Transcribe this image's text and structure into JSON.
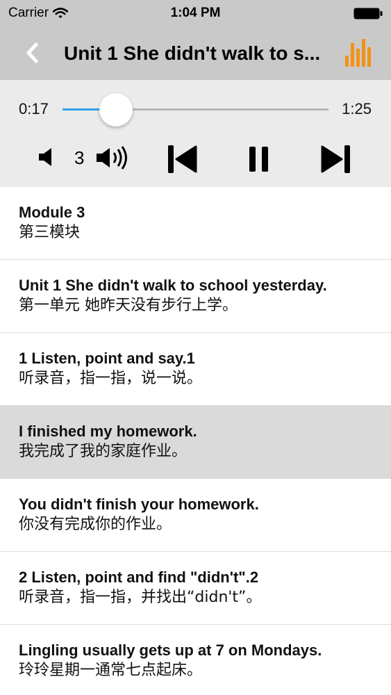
{
  "status_bar": {
    "carrier": "Carrier",
    "time": "1:04 PM"
  },
  "nav": {
    "title": "Unit 1 She didn't walk to s..."
  },
  "player": {
    "current_time": "0:17",
    "duration": "1:25",
    "progress": 0.2,
    "volume": "3",
    "accent": "#2fa3e6"
  },
  "icons": {
    "back": "chevron-left-icon",
    "equalizer": "equalizer-icon",
    "volume_down": "speaker-low-icon",
    "volume_up": "speaker-high-icon",
    "previous": "skip-previous-icon",
    "pause": "pause-icon",
    "next": "skip-next-icon",
    "equalizer_color": "#f39217"
  },
  "items": [
    {
      "en": "Module 3",
      "zh": "第三模块"
    },
    {
      "en": "Unit 1 She didn't walk to school yesterday.",
      "zh": "第一单元 她昨天没有步行上学。"
    },
    {
      "en": "1 Listen, point and say.1",
      "zh": "听录音，指一指，说一说。"
    },
    {
      "en": "I finished my homework.",
      "zh": "我完成了我的家庭作业。",
      "selected": true
    },
    {
      "en": "You didn't finish your homework.",
      "zh": "你没有完成你的作业。"
    },
    {
      "en": "2 Listen, point and find \"didn't\".2",
      "zh": "听录音，指一指，并找出“didn't”。"
    },
    {
      "en": "Lingling usually gets up at 7 on Mondays.",
      "zh": "玲玲星期一通常七点起床。"
    }
  ]
}
